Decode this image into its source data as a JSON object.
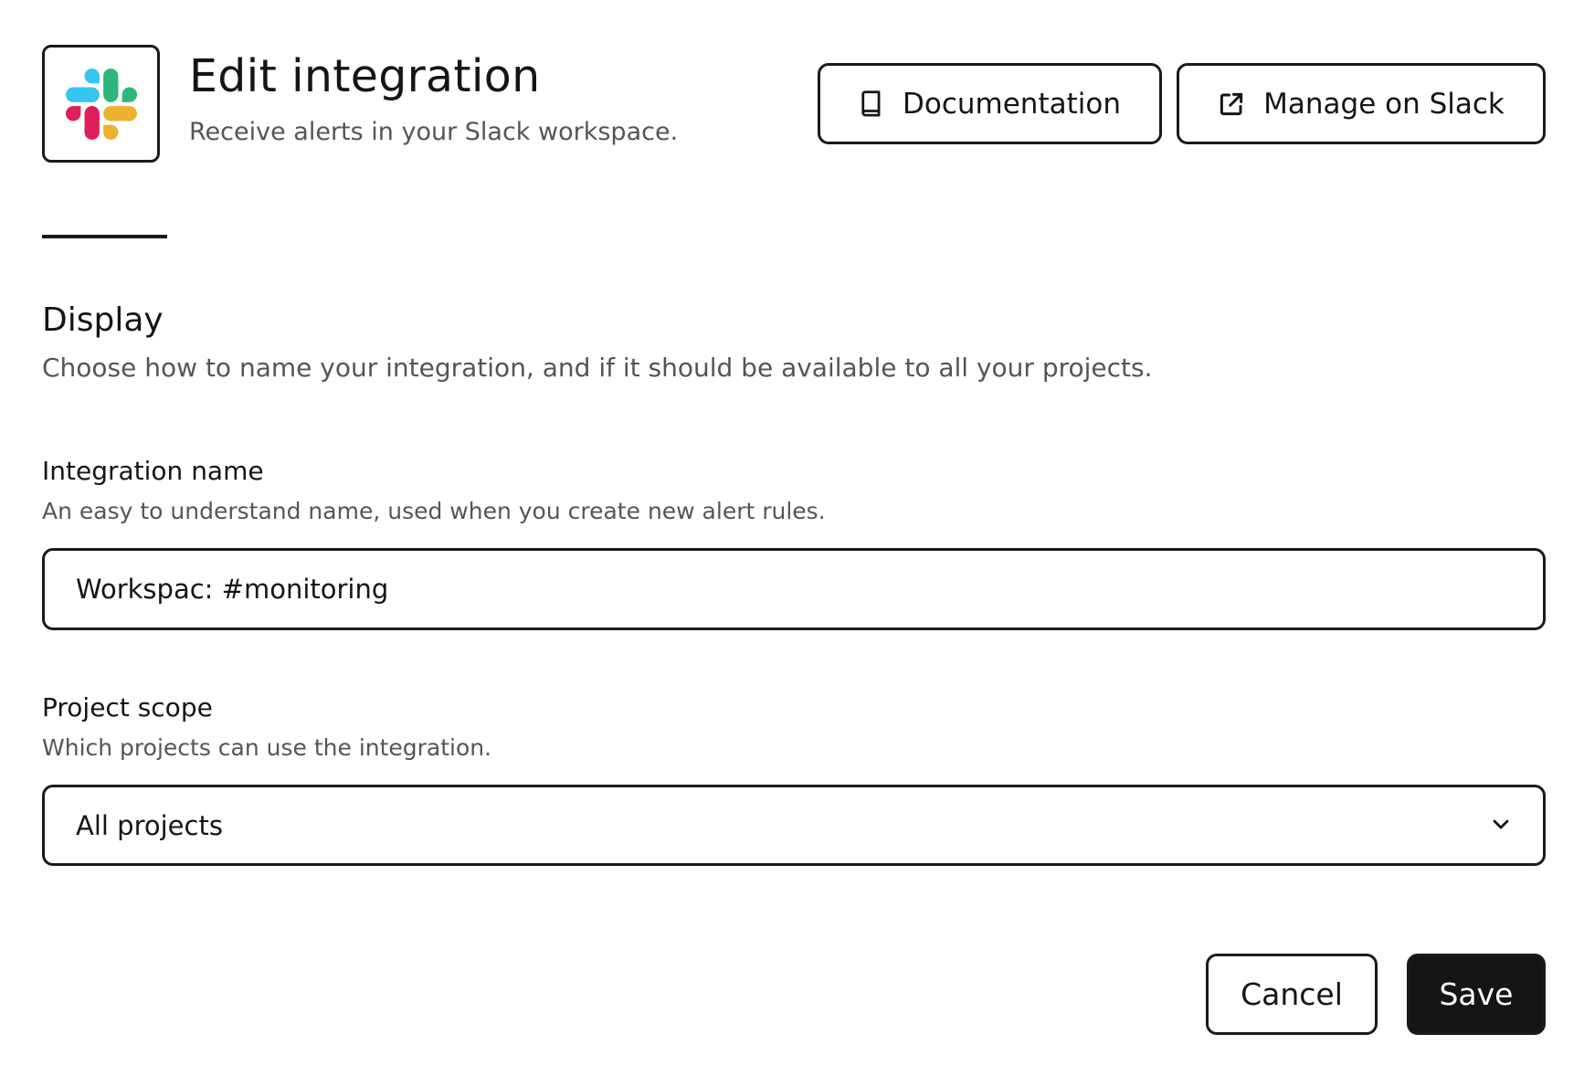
{
  "header": {
    "logo_icon": "slack-logo-icon",
    "title": "Edit integration",
    "subtitle": "Receive alerts in your Slack workspace.",
    "documentation_button": {
      "label": "Documentation",
      "icon": "book-icon"
    },
    "manage_button": {
      "label": "Manage on Slack",
      "icon": "external-link-icon"
    }
  },
  "section": {
    "title": "Display",
    "description": "Choose how to name your integration, and if it should be available to all your projects."
  },
  "integration_name": {
    "label": "Integration name",
    "help": "An easy to understand name, used when you create new alert rules.",
    "value": "Workspac: #monitoring"
  },
  "project_scope": {
    "label": "Project scope",
    "help": "Which projects can use the integration.",
    "selected": "All projects",
    "icon": "chevron-down-icon"
  },
  "actions": {
    "cancel_label": "Cancel",
    "save_label": "Save"
  },
  "colors": {
    "slack_blue": "#36C5F0",
    "slack_green": "#2EB67D",
    "slack_yellow": "#ECB22E",
    "slack_red": "#E01E5A",
    "primary": "#151515"
  }
}
